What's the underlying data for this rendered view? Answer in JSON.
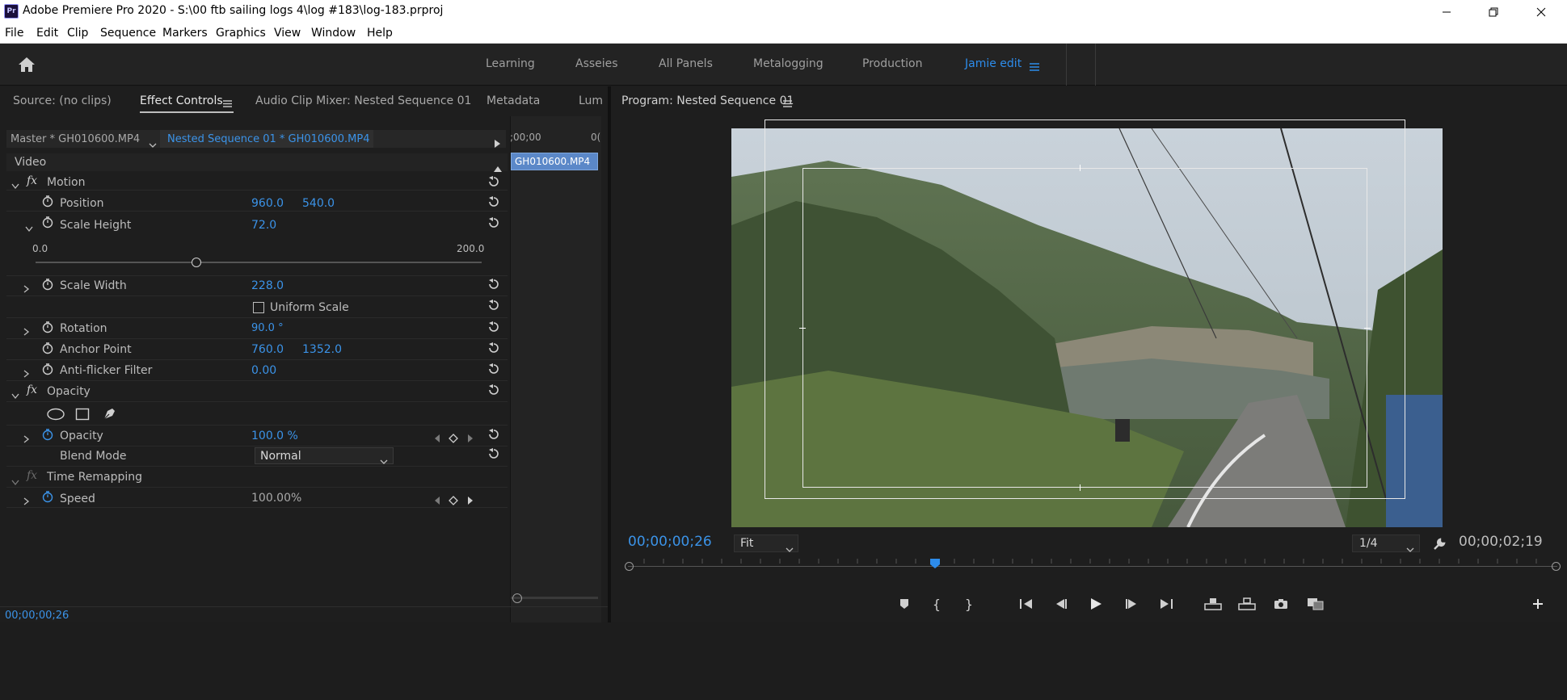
{
  "window": {
    "title": "Adobe Premiere Pro 2020 - S:\\00 ftb sailing logs 4\\log #183\\log-183.prproj",
    "app_badge": "Pr"
  },
  "menu": [
    "File",
    "Edit",
    "Clip",
    "Sequence",
    "Markers",
    "Graphics",
    "View",
    "Window",
    "Help"
  ],
  "workspaces": [
    "Learning",
    "Asseies",
    "All Panels",
    "Metalogging",
    "Production",
    "Jamie edit"
  ],
  "left_tabs": [
    "Source: (no clips)",
    "Effect Controls",
    "Audio Clip Mixer: Nested Sequence 01",
    "Metadata",
    "Lum"
  ],
  "source_bar": {
    "master": "Master * GH010600.MP4",
    "sequence_clip": "Nested Sequence 01 * GH010600.MP4",
    "ruler_start": ";00;00",
    "ruler_next": "0(",
    "clip_name": "GH010600.MP4"
  },
  "effects": {
    "video_label": "Video",
    "motion_label": "Motion",
    "position_label": "Position",
    "position_x": "960.0",
    "position_y": "540.0",
    "scale_height_label": "Scale Height",
    "scale_height_value": "72.0",
    "scale_height_level": 0.36,
    "slider_min": "0.0",
    "slider_max": "200.0",
    "scale_width_label": "Scale Width",
    "scale_width_value": "228.0",
    "uniform_scale_label": "Uniform Scale",
    "rotation_label": "Rotation",
    "rotation_value": "90.0 °",
    "anchor_label": "Anchor Point",
    "anchor_x": "760.0",
    "anchor_y": "1352.0",
    "antiflicker_label": "Anti-flicker Filter",
    "antiflicker_value": "0.00",
    "opacity_group_label": "Opacity",
    "opacity_label": "Opacity",
    "opacity_value": "100.0 %",
    "blend_label": "Blend Mode",
    "blend_value": "Normal",
    "time_remap_label": "Time Remapping",
    "speed_label": "Speed",
    "speed_value": "100.00%"
  },
  "left_timecode": "00;00;00;26",
  "program": {
    "title": "Program: Nested Sequence 01",
    "timecode_current": "00;00;00;26",
    "fit_value": "Fit",
    "resolution_value": "1/4",
    "timecode_duration": "00;00;02;19",
    "playhead_fraction": 0.33
  },
  "colors": {
    "accent": "#2d8ceb",
    "panel": "#1e1e1e"
  }
}
